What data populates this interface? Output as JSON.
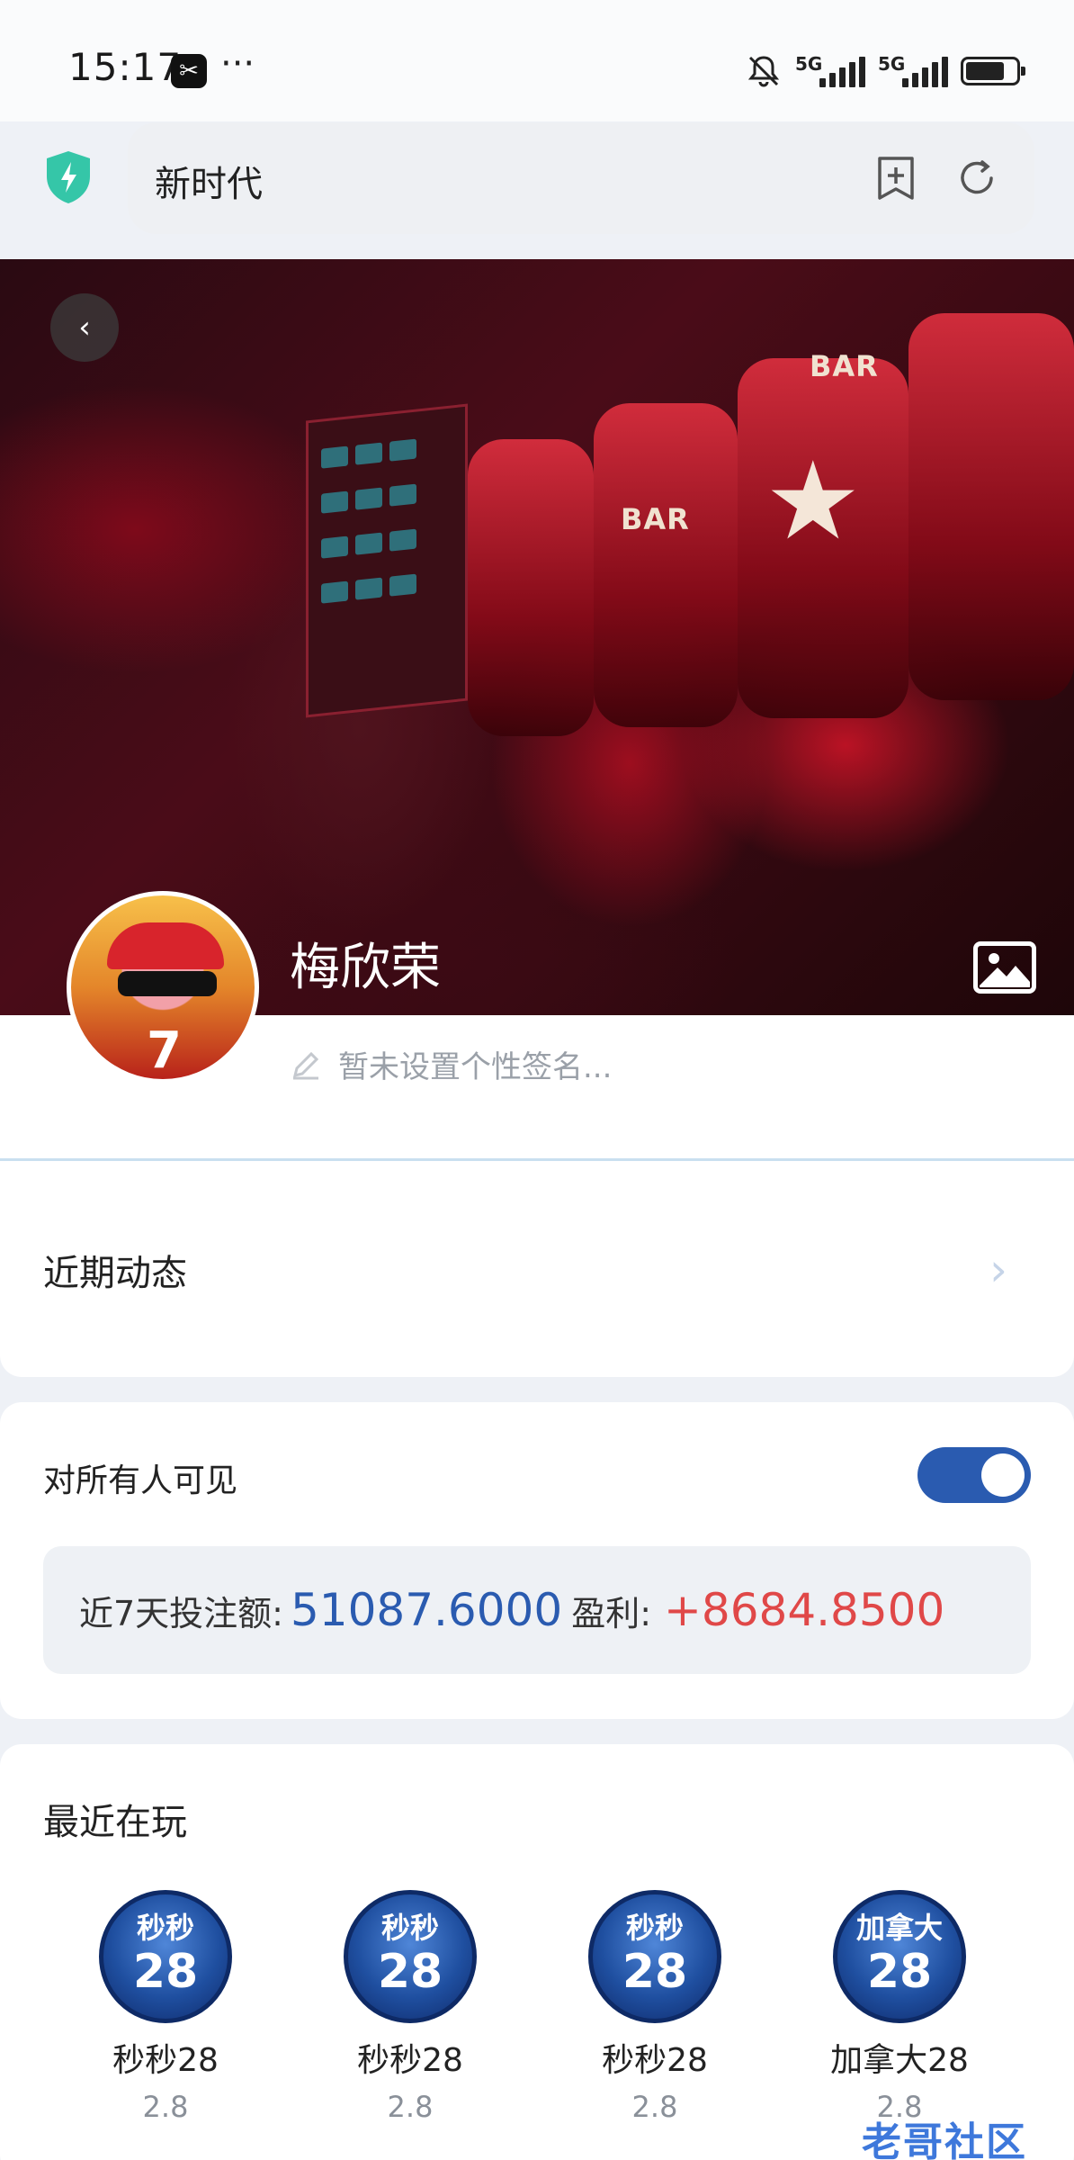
{
  "status_bar": {
    "time": "15:17",
    "capcut_glyph": "✂",
    "more": "···",
    "signal1": "5G",
    "signal2": "5G"
  },
  "browser": {
    "url": "新时代"
  },
  "profile": {
    "username": "梅欣荣",
    "signature_placeholder": "暂未设置个性签名..."
  },
  "recent_activity": {
    "label": "近期动态"
  },
  "visibility": {
    "label": "对所有人可见",
    "enabled": true
  },
  "stats": {
    "bet_label": "近7天投注额:",
    "bet_value": "51087.6000",
    "profit_label": "盈利:",
    "profit_value": "+8684.8500",
    "bet_color": "#2a5bb0",
    "profit_color": "#e04848"
  },
  "recently_played": {
    "title": "最近在玩",
    "games": [
      {
        "icon_text": "秒秒",
        "icon_num": "28",
        "name": "秒秒28",
        "odds": "2.8"
      },
      {
        "icon_text": "秒秒",
        "icon_num": "28",
        "name": "秒秒28",
        "odds": "2.8"
      },
      {
        "icon_text": "秒秒",
        "icon_num": "28",
        "name": "秒秒28",
        "odds": "2.8"
      },
      {
        "icon_text": "加拿大",
        "icon_num": "28",
        "name": "加拿大28",
        "odds": "2.8"
      }
    ]
  },
  "watermark": "老哥社区"
}
